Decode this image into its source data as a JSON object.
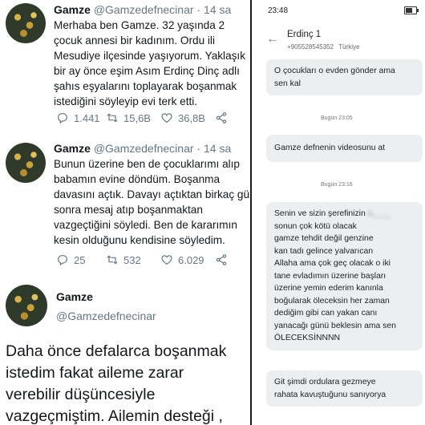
{
  "tweets": [
    {
      "name": "Gamze",
      "handle": "@Gamzedefnecinar",
      "time": "14 sa",
      "text": "Merhaba ben Gamze. 32 yaşında 2\nçocuk annesi bir kadınım. Ordu ili\nMesudiye ilçesinde yaşıyorum. Yaklaşık\nbir ay önce eşim Asım Erdinç Dinç adlı\nşahıs eşyalarını toplayarak boşanmak\nistediğini söyleyip evi terk etti.",
      "replies": "1.441",
      "retweets": "15,6B",
      "likes": "36,8B"
    },
    {
      "name": "Gamze",
      "handle": "@Gamzedefnecinar",
      "time": "14 sa",
      "text": "Bunun üzerine ben de çocuklarımı alıp\nbabamın evine döndüm. Boşanma\ndavasını açtık. Davayı açtıktan birkaç gü\nsonra mesaj atıp boşanmaktan\nvazgeçtiğini söyledi. Ben de kararımın\nkesin olduğunu kendisine söyledim.",
      "replies": "25",
      "retweets": "532",
      "likes": "6.029"
    },
    {
      "name": "Gamze",
      "handle": "@Gamzedefnecinar",
      "text": "Daha önce defalarca boşanmak\nistedim fakat aileme zarar\nverebilir düşüncesiyle\nvazgeçmiştim. Ailemin desteği ,"
    }
  ],
  "phone": {
    "status_time": "23:48",
    "battery_level": 0.7,
    "contact_name": "Erdinç 1",
    "contact_number": "+905528545352",
    "contact_country": "Türkiye",
    "messages": [
      {
        "text": "O çocukları o evden gönder ama\nsen kal"
      },
      {
        "timestamp": "Bugün 23:05",
        "text": "Gamze defnenin videosunu at"
      },
      {
        "timestamp": "Bugün 23:16",
        "text_pre": "Senin ve sizin şerefinizin ",
        "text_blurred": "a____",
        "text_post": "\nsonun çok kötü olacak\ngamze tehdit değil genzine\nkan tadı gelince yalvarıcan\nAllaha ama çok geç olacak o iki\ntane evladımın üzerine başları\nüzerine yemin ederim kanınla\nboğularak öleceksin her zaman\ndediğim gibi can yakan canı\nyanacağı günü beklesin ama sen\nÖLECEKSİNNNN"
      },
      {
        "text": "Git şimdi ordulara gezmeye\nrahata kavuştuğunu sanıyorya"
      }
    ]
  },
  "colors": {
    "text_primary": "#14171a",
    "text_secondary": "#657786",
    "bubble_bg": "#eceef0",
    "back_arrow": "#4a9b5e"
  }
}
